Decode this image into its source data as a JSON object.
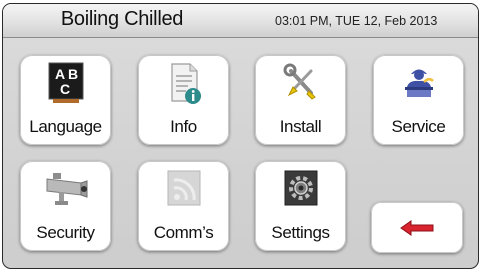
{
  "header": {
    "title": "Boiling Chilled",
    "datetime": "03:01 PM, TUE 12, Feb 2013"
  },
  "menu": {
    "language": {
      "label": "Language",
      "icon": "language-icon",
      "icon_text": [
        "A",
        "B",
        "C"
      ]
    },
    "info": {
      "label": "Info",
      "icon": "info-document-icon"
    },
    "install": {
      "label": "Install",
      "icon": "install-tools-icon"
    },
    "service": {
      "label": "Service",
      "icon": "service-technician-icon"
    },
    "security": {
      "label": "Security",
      "icon": "security-camera-icon"
    },
    "comms": {
      "label": "Comm’s",
      "icon": "wifi-signal-icon"
    },
    "settings": {
      "label": "Settings",
      "icon": "settings-gear-icon"
    },
    "back": {
      "icon": "back-arrow-icon"
    }
  },
  "colors": {
    "accent_red": "#d9232e",
    "info_teal": "#2e8b8b",
    "service_blue": "#3f51a5"
  }
}
